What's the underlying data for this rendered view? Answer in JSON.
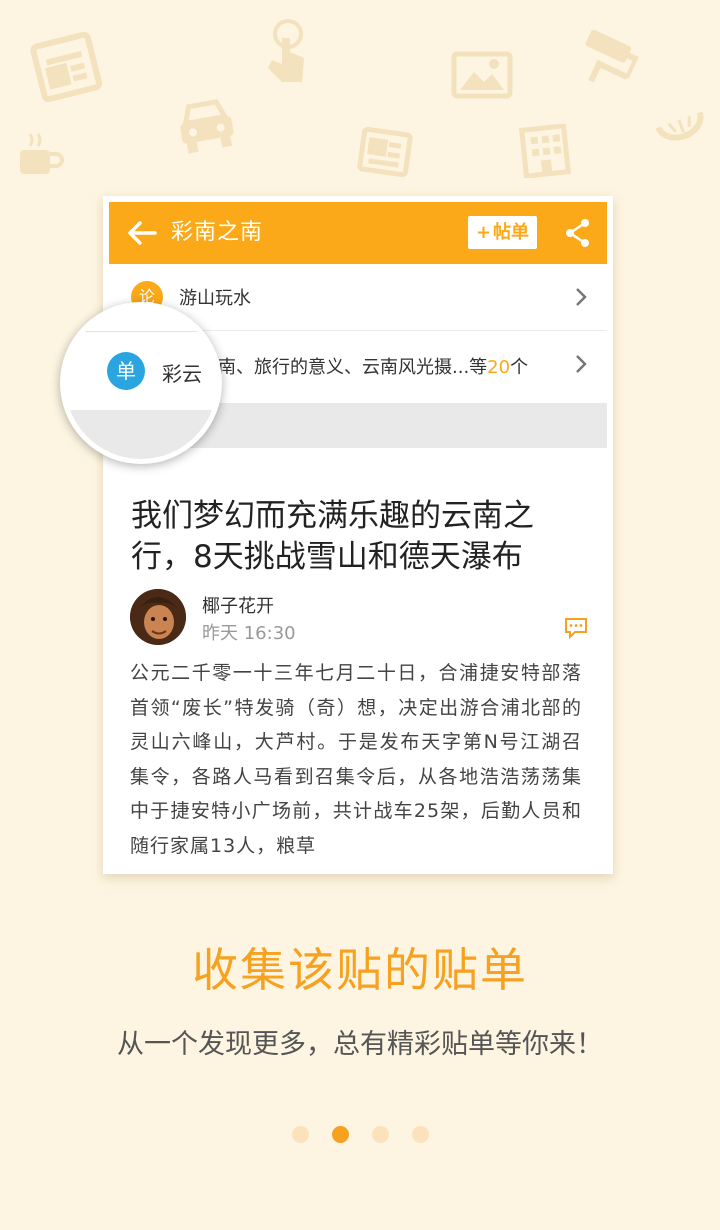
{
  "header": {
    "title": "彩南之南",
    "tie_button_plus": "+",
    "tie_button_label": "帖单"
  },
  "rows": [
    {
      "badge": "论",
      "label": "游山玩水"
    },
    {
      "badge": "单",
      "label_prefix": "彩云之南、旅行的意义、云南风光摄...等",
      "count": "20",
      "label_suffix": "个"
    }
  ],
  "magnifier": {
    "badge": "单",
    "text": "彩云"
  },
  "article": {
    "title": "我们梦幻而充满乐趣的云南之行，8天挑战雪山和德天瀑布",
    "author": "椰子花开",
    "time": "昨天 16:30",
    "body": "公元二千零一十三年七月二十日，合浦捷安特部落首领“废长”特发骑（奇）想，决定出游合浦北部的灵山六峰山，大芦村。于是发布天字第N号江湖召集令，各路人马看到召集令后，从各地浩浩荡荡集中于捷安特小广场前，共计战车25架，后勤人员和随行家属13人，粮草"
  },
  "promo": {
    "headline": "收集该贴的贴单",
    "subline": "从一个发现更多，总有精彩贴单等你来！"
  },
  "pager": {
    "count": 4,
    "active_index": 1
  },
  "colors": {
    "accent": "#fba918",
    "background": "#fdf5e1",
    "badge_blue": "#2aa5e0"
  },
  "icons": [
    "news-icon",
    "hand-tap-icon",
    "car-icon",
    "coffee-icon",
    "newspaper-icon",
    "picture-icon",
    "building-icon",
    "paint-roller-icon",
    "fruit-slice-icon",
    "back-arrow-icon",
    "share-icon",
    "chevron-right-icon",
    "comment-icon"
  ]
}
